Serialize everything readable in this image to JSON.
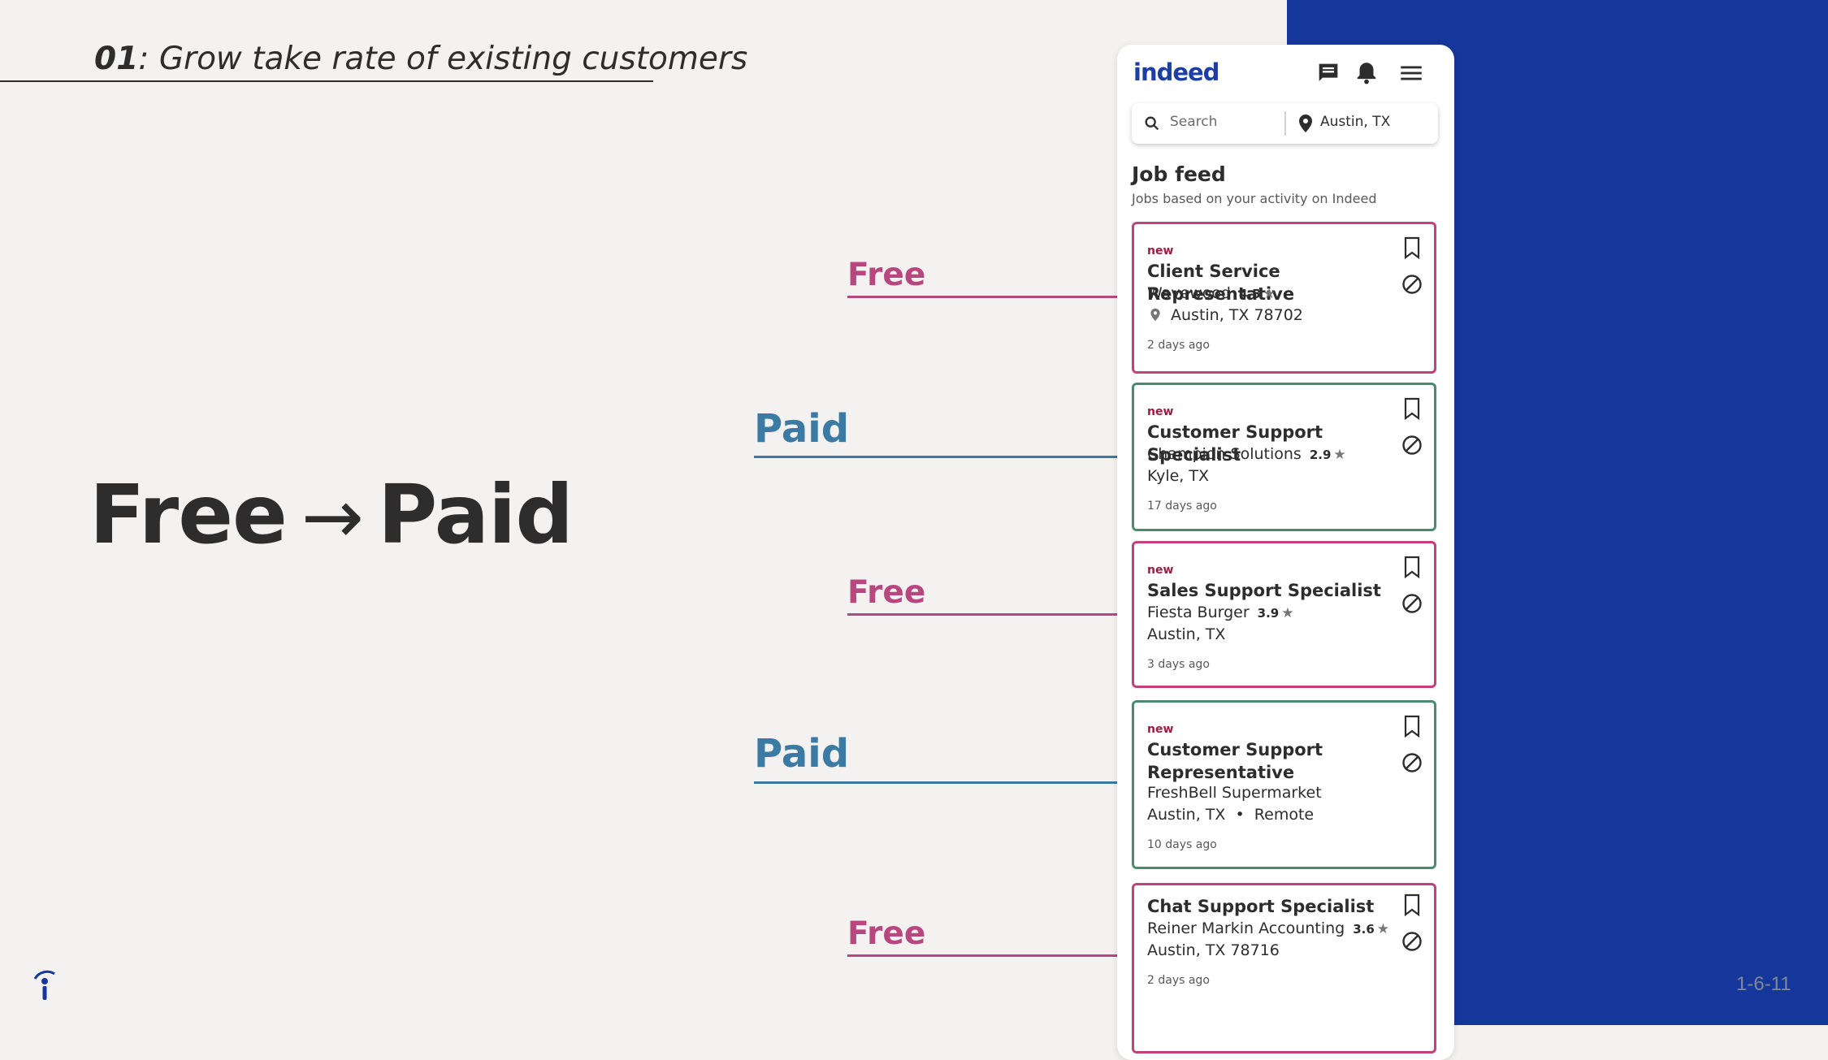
{
  "slide": {
    "title_number": "01",
    "title_text": ": Grow take rate of existing customers",
    "headline_from": "Free",
    "headline_arrow": "→",
    "headline_to": "Paid",
    "page_number": "1-6-11"
  },
  "tags": [
    "Free",
    "Paid",
    "Free",
    "Paid",
    "Free"
  ],
  "app": {
    "brand": "indeed",
    "search_placeholder": "Search",
    "location_value": "Austin, TX",
    "feed_title": "Job feed",
    "feed_subtitle": "Jobs based on your activity on Indeed"
  },
  "jobs": [
    {
      "new": "new",
      "title": "Client Service Representative",
      "company": "Wavewood",
      "rating": "4.5",
      "location": "Austin, TX 78702",
      "posted": "2 days ago",
      "type": "free"
    },
    {
      "new": "new",
      "title": "Customer Support Specialist",
      "company": "Champion Solutions",
      "rating": "2.9",
      "location": "Kyle, TX",
      "posted": "17 days ago",
      "type": "paid"
    },
    {
      "new": "new",
      "title": "Sales Support Specialist",
      "company": "Fiesta Burger",
      "rating": "3.9",
      "location": "Austin, TX",
      "posted": "3 days ago",
      "type": "free"
    },
    {
      "new": "new",
      "title": "Customer Support Representative",
      "company": "FreshBell Supermarket",
      "rating": "",
      "location": "Austin, TX  •  Remote",
      "posted": "10 days ago",
      "type": "paid"
    },
    {
      "new": "",
      "title": "Chat Support Specialist",
      "company": "Reiner Markin Accounting",
      "rating": "3.6",
      "location": "Austin, TX 78716",
      "posted": "2 days ago",
      "type": "free"
    }
  ],
  "colors": {
    "free": "#b8467f",
    "paid": "#3a7aa3",
    "panel": "#15379b",
    "brand": "#1d3fa5"
  },
  "icons": [
    "messages-icon",
    "bell-icon",
    "menu-icon",
    "search-icon",
    "location-pin-icon",
    "bookmark-icon",
    "not-interested-icon",
    "star-icon",
    "indeed-logo-icon"
  ]
}
